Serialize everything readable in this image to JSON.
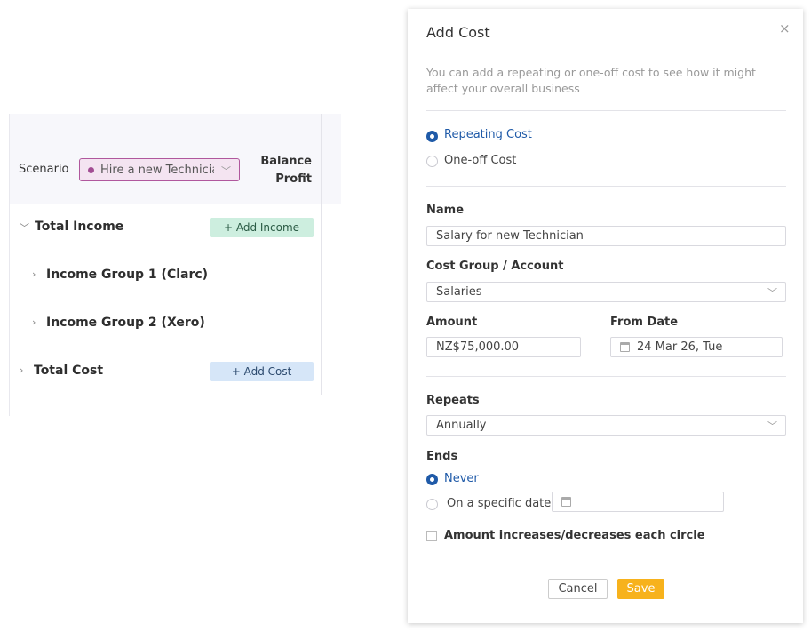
{
  "table": {
    "scenario_label": "Scenario",
    "scenario_value": "Hire a new Technician",
    "balance_label_line1": "Balance",
    "balance_label_line2": "Profit",
    "rows": [
      {
        "label": "Total Income",
        "expanded": true,
        "button": "+ Add Income"
      },
      {
        "label": "Income Group 1 (Clarc)"
      },
      {
        "label": "Income Group 2 (Xero)"
      },
      {
        "label": "Total Cost",
        "expanded": false,
        "button": "+ Add Cost"
      }
    ]
  },
  "modal": {
    "title": "Add Cost",
    "close_glyph": "×",
    "description": "You can add a repeating or one-off cost to see how it might affect your overall business",
    "cost_types": [
      {
        "label": "Repeating Cost",
        "selected": true
      },
      {
        "label": "One-off Cost",
        "selected": false
      }
    ],
    "name_label": "Name",
    "name_value": "Salary for new Technician",
    "cost_group_label": "Cost Group / Account",
    "cost_group_value": "Salaries",
    "amount_label": "Amount",
    "amount_value": "NZ$75,000.00",
    "from_date_label": "From Date",
    "from_date_value": "24 Mar 26, Tue",
    "repeats_label": "Repeats",
    "repeats_value": "Annually",
    "ends_label": "Ends",
    "ends_options": [
      {
        "label": "Never",
        "selected": true
      },
      {
        "label": "On a specific date",
        "selected": false
      }
    ],
    "increase_checkbox_label": "Amount increases/decreases each circle",
    "increase_checked": false,
    "cancel_label": "Cancel",
    "save_label": "Save"
  },
  "colors": {
    "accent_blue": "#1f5aa8",
    "save_orange": "#f7b21c",
    "scenario_purple": "#a24d93",
    "income_green": "#cdeedf",
    "cost_blue": "#d6e6f8"
  }
}
